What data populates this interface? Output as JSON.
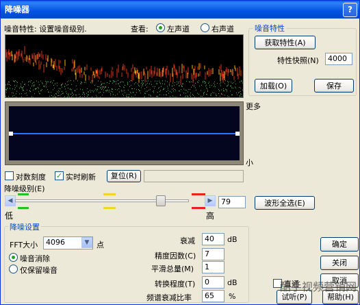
{
  "window": {
    "title": "降噪器",
    "help_glyph": "?"
  },
  "top": {
    "noise_profile_label": "噪音特性: 设置噪音级别.",
    "view_label": "查看:",
    "left_channel": "左声道",
    "right_channel": "右声道",
    "selected_channel": "left"
  },
  "profile_group": {
    "title": "噪音特性",
    "get_profile": "获取特性(A)",
    "snapshots_label": "特性快照(N)",
    "snapshots_value": "4000",
    "load": "加载(O)",
    "save": "保存"
  },
  "curve_labels": {
    "more": "更多",
    "less": "小"
  },
  "options": {
    "log_scale": "对数刻度",
    "log_scale_checked": false,
    "live_update": "实时刷新",
    "live_update_checked": true,
    "reset": "复位(R)"
  },
  "reduction": {
    "label": "降噪级别(E)",
    "low": "低",
    "high": "高",
    "value": "79",
    "select_all": "波形全选(E)",
    "marker_colors": [
      "#22C322",
      "#F2D624",
      "#E8221C"
    ]
  },
  "settings_group": {
    "title": "降噪设置",
    "fft_label": "FFT大小",
    "fft_value": "4096",
    "fft_unit": "点",
    "mode_remove": "噪音消除",
    "mode_keep": "仅保留噪音",
    "mode_selected": "remove",
    "attenuation_label": "衰减",
    "attenuation_value": "40",
    "attenuation_unit": "dB",
    "precision_label": "精度因数(C)",
    "precision_value": "7",
    "smoothing_label": "平滑总量(M)",
    "smoothing_value": "1",
    "transition_label": "转换程度(T)",
    "transition_value": "0",
    "transition_unit": "dB",
    "spectral_label": "频谱衰减比率",
    "spectral_value": "65",
    "spectral_unit": "%"
  },
  "buttons": {
    "ok": "确定",
    "close": "关闭",
    "cancel": "取消",
    "bypass": "直通",
    "preview": "试听(P)",
    "help": "帮助(H)"
  },
  "watermark": "酷手视频营销网",
  "colors": {
    "title_bar": "#0053E1",
    "group_title": "#0046D5",
    "curve_line": "#2B73FF",
    "spectrum_red": "#D8321A",
    "spectrum_green": "#4FBF4F"
  }
}
